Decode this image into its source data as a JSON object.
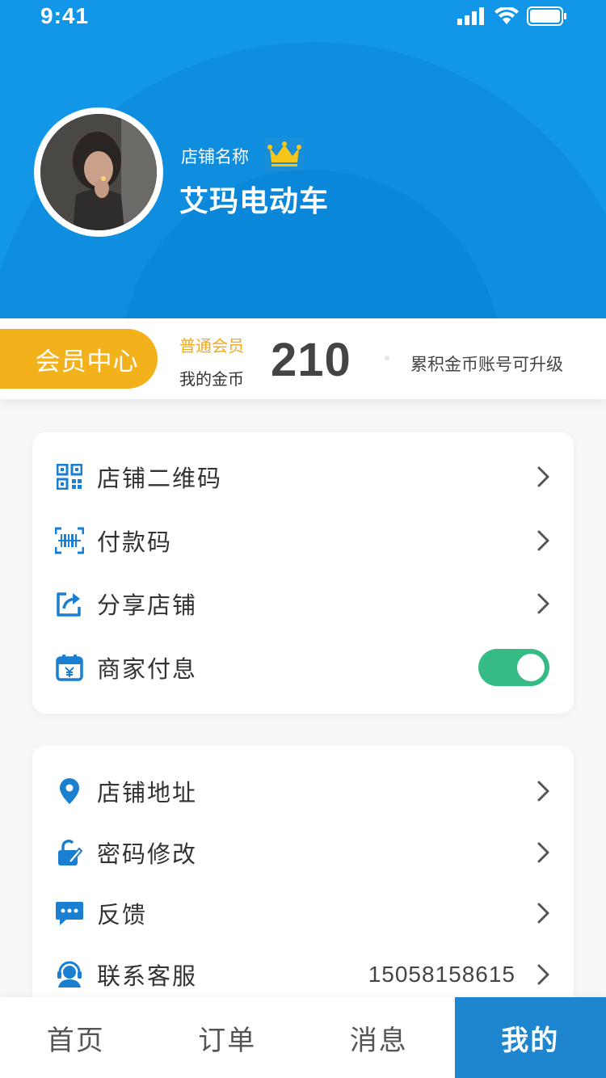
{
  "status_bar": {
    "time": "9:41"
  },
  "profile": {
    "shop_label": "店铺名称",
    "shop_name": "艾玛电动车"
  },
  "member": {
    "button_label": "会员中心",
    "level": "普通会员",
    "coin_label": "我的金币",
    "coin_value": "210",
    "upgrade_hint": "累积金币账号可升级"
  },
  "menu_group_1": [
    {
      "label": "店铺二维码",
      "icon": "qr-code-icon"
    },
    {
      "label": "付款码",
      "icon": "barcode-scan-icon"
    },
    {
      "label": "分享店铺",
      "icon": "share-icon"
    },
    {
      "label": "商家付息",
      "icon": "calendar-yen-icon",
      "toggle": true
    }
  ],
  "menu_group_2": [
    {
      "label": "店铺地址",
      "icon": "location-pin-icon"
    },
    {
      "label": "密码修改",
      "icon": "lock-edit-icon"
    },
    {
      "label": "反馈",
      "icon": "chat-bubble-icon"
    },
    {
      "label": "联系客服",
      "icon": "customer-service-icon",
      "value": "15058158615"
    }
  ],
  "tabs": [
    {
      "label": "首页"
    },
    {
      "label": "订单"
    },
    {
      "label": "消息"
    },
    {
      "label": "我的",
      "active": true
    }
  ],
  "colors": {
    "header_blue": "#1296e8",
    "member_gold": "#f3b21b",
    "toggle_green": "#37bb84",
    "tab_active": "#1d86cf",
    "icon_blue": "#1a7fd0"
  }
}
